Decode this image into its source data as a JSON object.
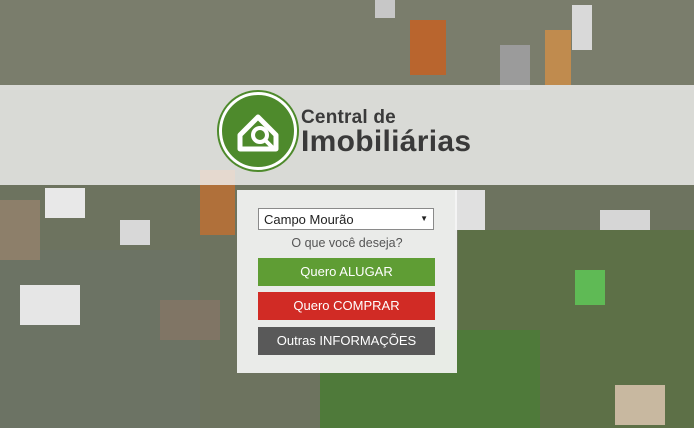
{
  "logo": {
    "line1": "Central de",
    "line2": "Imobiliárias",
    "brand_color": "#4e8a2c",
    "icon": "house-magnifier-icon"
  },
  "form": {
    "city_selected": "Campo Mourão",
    "question": "O que você deseja?",
    "buttons": {
      "alugar": "Quero ALUGAR",
      "comprar": "Quero COMPRAR",
      "outras": "Outras INFORMAÇÕES"
    },
    "colors": {
      "alugar": "#5f9d34",
      "comprar": "#d12b25",
      "outras": "#595959"
    }
  }
}
